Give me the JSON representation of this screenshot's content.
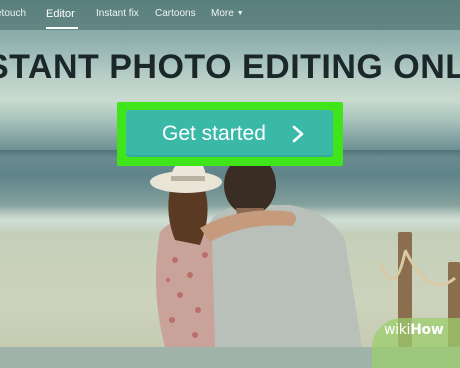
{
  "nav": {
    "items": [
      {
        "label": "etouch"
      },
      {
        "label": "Editor",
        "active": true
      },
      {
        "label": "Instant fix"
      },
      {
        "label": "Cartoons"
      },
      {
        "label": "More"
      }
    ],
    "more_icon": "caret-down-icon"
  },
  "hero": {
    "headline": "STANT PHOTO EDITING ONLI",
    "cta_label": "Get started",
    "cta_icon": "chevron-right-icon"
  },
  "watermark": {
    "part1": "wiki",
    "part2": "How"
  },
  "colors": {
    "cta_background": "#3bb9a8",
    "highlight_frame": "#3fe41a",
    "headline": "#0f1a1d"
  }
}
